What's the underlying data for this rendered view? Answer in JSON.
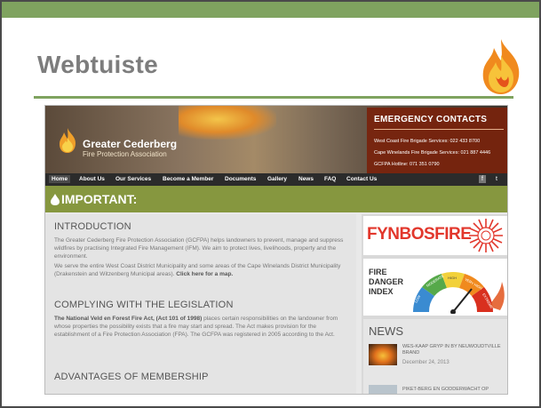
{
  "slide": {
    "title": "Webtuiste",
    "colors": {
      "accent": "#7fa35f",
      "frame": "#4a4a4a"
    }
  },
  "site": {
    "brand": {
      "name": "Greater Cederberg",
      "subtitle": "Fire Protection Association"
    },
    "emergency": {
      "title": "EMERGENCY CONTACTS",
      "lines": [
        "West Coast Fire Brigade Services: 022 433 8700",
        "Cape Winelands Fire Brigade Services: 021 887 4446",
        "GCFPA Hotline: 071 351 0790"
      ]
    },
    "nav": [
      "Home",
      "About Us",
      "Our Services",
      "Become a Member",
      "Documents",
      "Gallery",
      "News",
      "FAQ",
      "Contact Us"
    ],
    "social": [
      "f",
      "t"
    ],
    "important": "IMPORTANT:",
    "intro": {
      "heading": "INTRODUCTION",
      "p1": "The Greater Cederberg Fire Protection Association (GCFPA) helps landowners to prevent, manage and suppress wildfires by practising Integrated Fire Management (IFM). We aim to protect lives, livelihoods, property and the environment.",
      "p2_text": "We serve the entire West Coast District Municipality and some areas of the Cape Winelands District Municipality (Drakenstein and Witzenberg Municipal areas).",
      "p2_link": "Click here for a map."
    },
    "legislation": {
      "heading": "COMPLYING WITH THE LEGISLATION",
      "bold": "The National Veld en Forest Fire Act, (Act 101 of 1998)",
      "text": "places certain responsibilities on the landowner from whose properties the possibility exists that a fire may start and spread. The Act makes provision for the establishment of a Fire Protection Association (FPA). The GCFPA was registered in 2005 according to the Act."
    },
    "membership": {
      "heading": "ADVANTAGES OF MEMBERSHIP"
    },
    "sidebar": {
      "fynbos": "FYNBOSFIRE",
      "fdi": [
        "FIRE",
        "DANGER",
        "INDEX"
      ],
      "gauge_labels": [
        "LOW",
        "MODERATE",
        "HIGH",
        "VERY HIGH",
        "EXTREME"
      ],
      "news_heading": "NEWS",
      "news": [
        {
          "title": "WES-KAAP GRYP IN BY NEUWOUDTVILLE BRAND",
          "date": "December 24, 2013"
        },
        {
          "title": "PIKET-BERG EN GODDERWACHT OP",
          "date": ""
        }
      ]
    }
  }
}
